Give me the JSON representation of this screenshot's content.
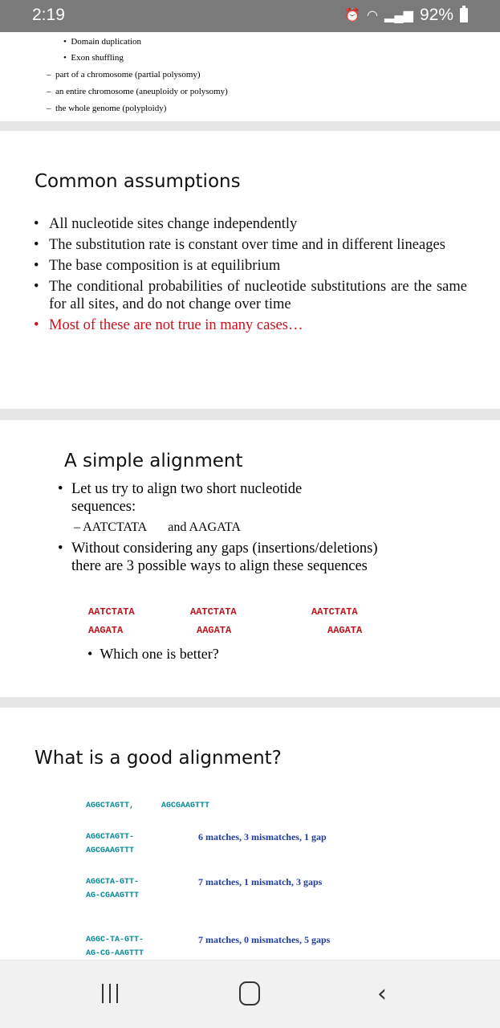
{
  "status_bar": {
    "time": "2:19",
    "battery": "92%",
    "icons": [
      "alarm-icon",
      "wifi-icon",
      "signal-icon",
      "battery-icon"
    ]
  },
  "slide1": {
    "bullets": [
      "Domain duplication",
      "Exon shuffling"
    ],
    "dashes": [
      "part of a chromosome (partial polysomy)",
      "an entire chromosome (aneuploidy or polysomy)",
      "the whole genome (polyploidy)"
    ]
  },
  "slide2": {
    "title": "Common assumptions",
    "bullets": [
      "All nucleotide sites change independently",
      "The substitution rate is constant over time  and in different lineages",
      "The base composition is at equilibrium",
      "The conditional probabilities of nucleotide  substitutions are the same for all sites, and  do not change over time"
    ],
    "red_bullet": "Most of these are not true in many cases…",
    "red_color": "#d0101c"
  },
  "slide3": {
    "title": "A simple alignment",
    "bullet1": "Let us try to align two short nucleotide sequences:",
    "dash1": "– AATCTATA",
    "dash2": "and AAGATA",
    "bullet2": "Without considering any gaps (insertions/deletions) there are 3 possible ways to align these sequences",
    "alignments": [
      {
        "top": "AATCTATA",
        "bottom": "AAGATA"
      },
      {
        "top": "AATCTATA",
        "bottom": "AAGATA"
      },
      {
        "top": "AATCTATA",
        "bottom": "AAGATA"
      }
    ],
    "question": "Which one is better?",
    "seq_color": "#c0141c"
  },
  "slide4": {
    "title": "What is a good alignment?",
    "seq1": "AGGCTAGTT,",
    "seq2": "AGCGAAGTTT",
    "alignments": [
      {
        "top": "AGGCTAGTT-",
        "bottom": "AGCGAAGTTT",
        "score": "6 matches, 3 mismatches, 1 gap"
      },
      {
        "top": "AGGCTA-GTT-",
        "bottom": "AG-CGAAGTTT",
        "score": "7 matches, 1 mismatch, 3 gaps"
      },
      {
        "top": "AGGC-TA-GTT-",
        "bottom": "AG-CG-AAGTTT",
        "score": "7 matches, 0 mismatches, 5 gaps"
      }
    ],
    "seq_color": "#0a8a96",
    "score_color": "#1f3da0"
  }
}
